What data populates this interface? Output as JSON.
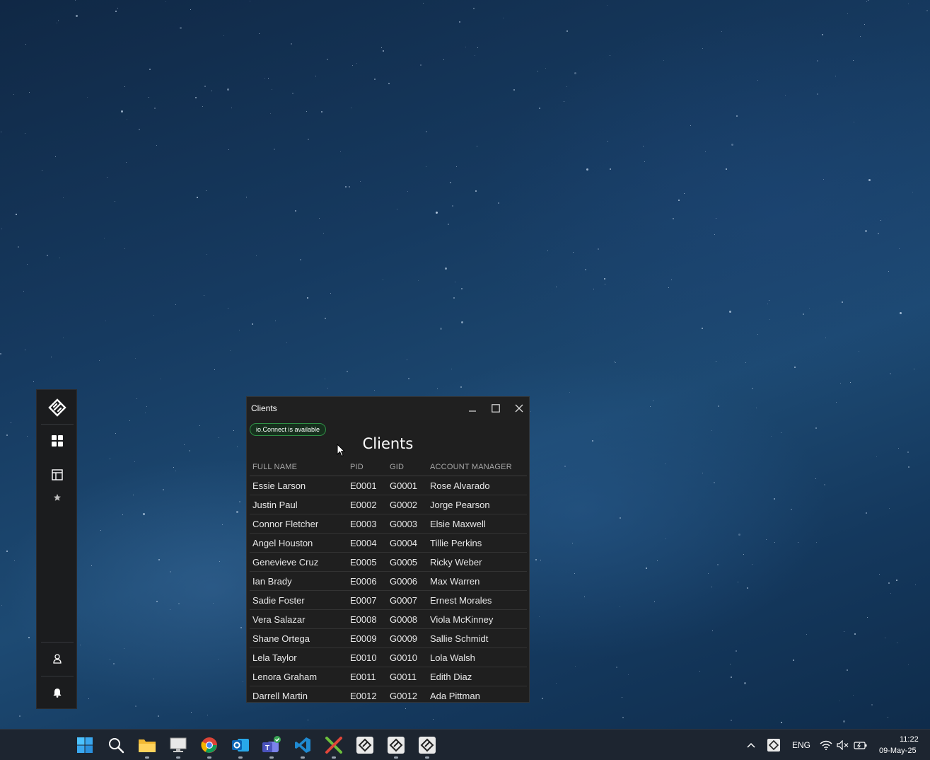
{
  "window": {
    "title": "Clients",
    "badge": "io.Connect is available",
    "heading": "Clients",
    "columns": [
      "FULL NAME",
      "PID",
      "GID",
      "ACCOUNT MANAGER"
    ],
    "rows": [
      {
        "name": "Essie Larson",
        "pid": "E0001",
        "gid": "G0001",
        "manager": "Rose Alvarado"
      },
      {
        "name": "Justin Paul",
        "pid": "E0002",
        "gid": "G0002",
        "manager": "Jorge Pearson"
      },
      {
        "name": "Connor Fletcher",
        "pid": "E0003",
        "gid": "G0003",
        "manager": "Elsie Maxwell"
      },
      {
        "name": "Angel Houston",
        "pid": "E0004",
        "gid": "G0004",
        "manager": "Tillie Perkins"
      },
      {
        "name": "Genevieve Cruz",
        "pid": "E0005",
        "gid": "G0005",
        "manager": "Ricky Weber"
      },
      {
        "name": "Ian Brady",
        "pid": "E0006",
        "gid": "G0006",
        "manager": "Max Warren"
      },
      {
        "name": "Sadie Foster",
        "pid": "E0007",
        "gid": "G0007",
        "manager": "Ernest Morales"
      },
      {
        "name": "Vera Salazar",
        "pid": "E0008",
        "gid": "G0008",
        "manager": "Viola McKinney"
      },
      {
        "name": "Shane Ortega",
        "pid": "E0009",
        "gid": "G0009",
        "manager": "Sallie Schmidt"
      },
      {
        "name": "Lela Taylor",
        "pid": "E0010",
        "gid": "G0010",
        "manager": "Lola Walsh"
      },
      {
        "name": "Lenora Graham",
        "pid": "E0011",
        "gid": "G0011",
        "manager": "Edith Diaz"
      },
      {
        "name": "Darrell Martin",
        "pid": "E0012",
        "gid": "G0012",
        "manager": "Ada Pittman"
      }
    ]
  },
  "launcher": {
    "items": [
      "io-connect-logo-icon",
      "apps-grid-icon",
      "layouts-icon",
      "favorites-star-icon",
      "user-icon",
      "notifications-bell-icon"
    ]
  },
  "taskbar": {
    "apps": [
      "windows-start-icon",
      "search-icon",
      "file-explorer-icon",
      "remote-desktop-icon",
      "chrome-icon",
      "outlook-icon",
      "teams-icon",
      "vscode-icon",
      "x-app-icon",
      "io-connect-icon",
      "io-connect-icon",
      "io-connect-icon"
    ],
    "language": "ENG",
    "time": "11:22",
    "date": "09-May-25"
  },
  "colors": {
    "badge_border": "#2f8f45",
    "window_bg": "#1f1f1f",
    "launcher_bg": "#1b1c1e",
    "taskbar_bg": "#1d2530"
  }
}
